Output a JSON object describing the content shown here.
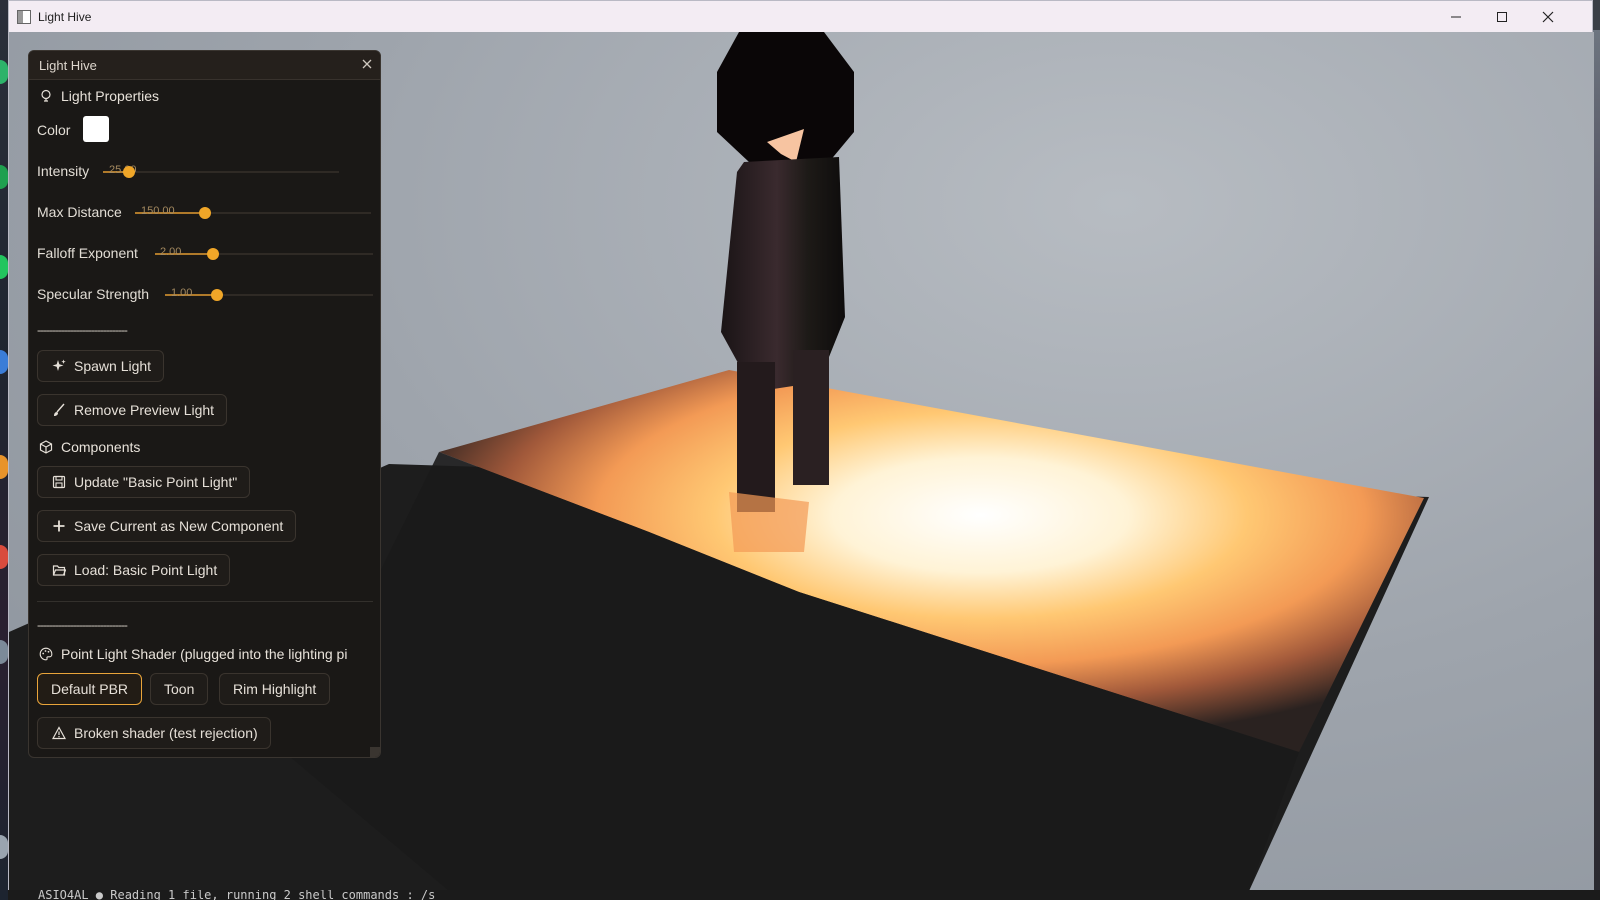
{
  "window": {
    "title": "Light Hive"
  },
  "panel": {
    "title": "Light Hive",
    "light_properties": {
      "heading": "Light Properties",
      "color_label": "Color",
      "color_value": "#ffffff",
      "sliders": [
        {
          "label": "Intensity",
          "value": "25.00"
        },
        {
          "label": "Max Distance",
          "value": "150.00"
        },
        {
          "label": "Falloff Exponent",
          "value": "2.00"
        },
        {
          "label": "Specular Strength",
          "value": "1.00"
        }
      ]
    },
    "divider_1": "------------------------------",
    "spawn_light": "Spawn Light",
    "remove_preview": "Remove Preview Light",
    "components": {
      "heading": "Components",
      "update_button": "Update \"Basic Point Light\"",
      "save_new_button": "Save Current as New Component",
      "load_button": "Load: Basic Point Light"
    },
    "divider_2": "------------------------------",
    "shader": {
      "heading": "Point Light Shader (plugged into the lighting pi",
      "options": [
        "Default PBR",
        "Toon",
        "Rim Highlight"
      ],
      "selected": "Default PBR",
      "broken_button": "Broken shader (test rejection)"
    }
  },
  "terminal_text": "ASIO4AL ● Reading 1 file, running 2 shell commands : /s",
  "colors": {
    "accent": "#f0a628",
    "panel_bg": "#1a1816",
    "titlebar_bg": "#f3ecf3"
  }
}
